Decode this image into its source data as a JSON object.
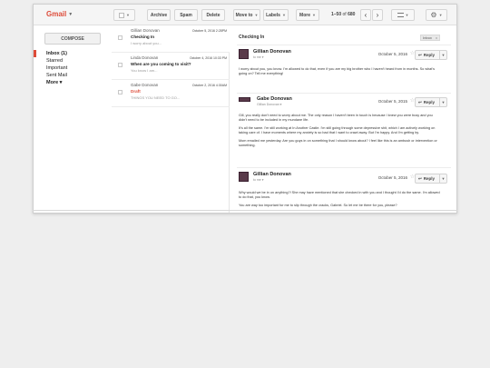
{
  "brand": {
    "name": "Gmail"
  },
  "toolbar": {
    "archive": "Archive",
    "spam": "Spam",
    "delete": "Delete",
    "move_to": "Move to",
    "labels": "Labels",
    "more": "More",
    "pager_range": "1–50",
    "pager_of": "of",
    "pager_total": "680",
    "prev": "‹",
    "next": "›"
  },
  "nav": {
    "compose": "COMPOSE",
    "items": [
      {
        "label": "Inbox (1)"
      },
      {
        "label": "Starred"
      },
      {
        "label": "Important"
      },
      {
        "label": "Sent Mail"
      },
      {
        "label": "More ▾"
      }
    ]
  },
  "list": {
    "rows": [
      {
        "from": "Gillian Donovan",
        "date": "October 5, 2016 2:28PM",
        "subject": "Checking In",
        "snippet": "I worry about you..."
      },
      {
        "from": "Linda Donovan",
        "date": "October 4, 2016 10:33 PM",
        "subject": "When are you coming to visit?",
        "snippet": "You know I am..."
      },
      {
        "from": "Gabe Donovan",
        "date": "October 2, 2016 4:30AM",
        "subject": "Draft",
        "snippet": "THINGS YOU NEED TO GO..."
      }
    ]
  },
  "pane": {
    "title": "Checking In",
    "label": "Inbox",
    "label_close": "x",
    "messages": [
      {
        "sender": "Gillian Donovan",
        "to": "to me ▾",
        "date": "October 5, 2016",
        "reply": "Reply",
        "paragraphs": [
          "I worry about you, you know. I'm allowed to do that, even if you are my big brother who I haven't heard from in months. So what's going on? Tell me everything!"
        ]
      },
      {
        "sender": "Gabe Donovan",
        "to": "Gillian Donovan ▾",
        "date": "October 5, 2015",
        "reply": "Reply",
        "paragraphs": [
          "Gill, you really don't need to worry about me. The only reason I haven't been in touch is because I knew you were busy and you didn't need to be included in my mundane life.",
          "It's all the same. I'm still working at In Another Castle. I'm still going through some depressive shit, which I am actively working on taking care of. I have moments where my anxiety is so bad that I want to crawl away. But I'm happy. And I'm getting by.",
          "Mom emailed me yesterday. Are you guys in on something that I should know about? I feel like this is an ambush or intervention or something."
        ]
      },
      {
        "sender": "Gillian Donovan",
        "to": "to me ▾",
        "date": "October 5, 2016",
        "reply": "Reply",
        "paragraphs": [
          "Why would we be in on anything?! She may have mentioned that she checked in with you and I thought I'd do the same. I'm allowed to do that, you know.",
          "You are way too important for me to slip through the cracks, Gabriel. So let me be there for you, please?"
        ]
      }
    ]
  }
}
